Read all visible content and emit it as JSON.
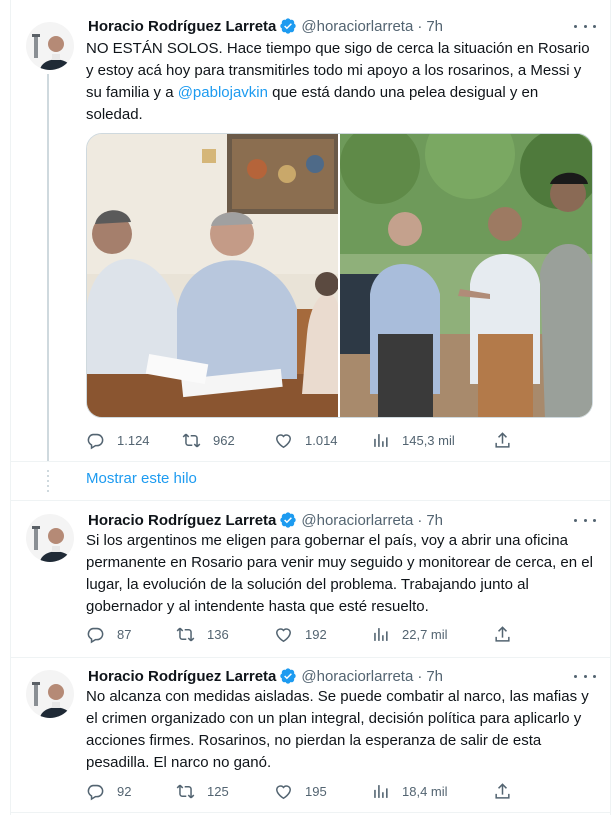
{
  "tweets": [
    {
      "author": "Horacio Rodríguez Larreta",
      "handle": "@horaciorlarreta",
      "separator": "·",
      "time": "7h",
      "text_pre": "NO ESTÁN SOLOS. Hace tiempo que sigo de cerca la situación en Rosario y estoy acá hoy para transmitirles todo mi apoyo a los rosarinos, a Messi y su familia y a ",
      "mention": "@pablojavkin",
      "text_post": " que está dando una pelea desigual y en soledad.",
      "replies": "1.124",
      "retweets": "962",
      "likes": "1.014",
      "views": "145,3 mil"
    },
    {
      "author": "Horacio Rodríguez Larreta",
      "handle": "@horaciorlarreta",
      "separator": "·",
      "time": "7h",
      "text": "Si los argentinos me eligen para gobernar el país, voy a abrir una oficina permanente en Rosario para venir muy seguido y monitorear de cerca, en el lugar, la evolución de la solución del problema. Trabajando junto al gobernador y al intendente hasta que esté resuelto.",
      "replies": "87",
      "retweets": "136",
      "likes": "192",
      "views": "22,7 mil"
    },
    {
      "author": "Horacio Rodríguez Larreta",
      "handle": "@horaciorlarreta",
      "separator": "·",
      "time": "7h",
      "text": "No alcanza con medidas aisladas. Se puede combatir al narco, las mafias y el crimen organizado con un plan integral, decisión política para aplicarlo y acciones firmes. Rosarinos, no pierdan la esperanza de salir de esta pesadilla. El narco no ganó.",
      "replies": "92",
      "retweets": "125",
      "likes": "195",
      "views": "18,4 mil"
    }
  ],
  "show_thread": "Mostrar este hilo",
  "colors": {
    "accent": "#1d9bf0",
    "secondary_text": "#536471",
    "border": "#eff3f4"
  },
  "icons": [
    "verified-badge-icon",
    "more-icon",
    "reply-icon",
    "retweet-icon",
    "like-icon",
    "views-icon",
    "share-icon"
  ]
}
